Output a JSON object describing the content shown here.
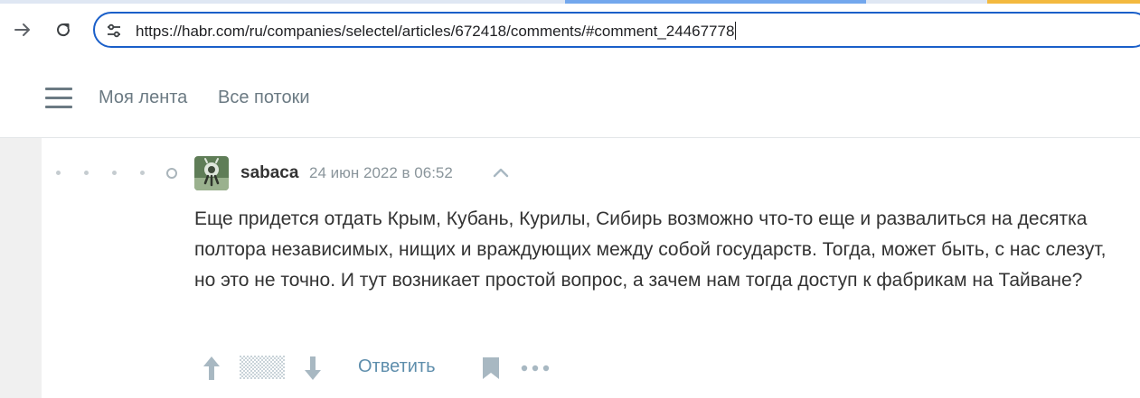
{
  "browser": {
    "url": "https://habr.com/ru/companies/selectel/articles/672418/comments/#comment_24467778",
    "forward_icon": "arrow-right-icon",
    "reload_icon": "reload-icon",
    "site_info_icon": "tune-icon"
  },
  "header": {
    "menu_icon": "hamburger-icon",
    "nav": [
      "Моя лента",
      "Все потоки"
    ]
  },
  "comment": {
    "author": "sabaca",
    "date": "24 июн 2022 в 06:52",
    "text": "Еще придется отдать Крым, Кубань, Курилы, Сибирь возможно что-то еще и развалиться на десятка полтора независимых, нищих и враждующих между собой государств. Тогда, может быть, с нас слезут, но это не точно. И тут возникает простой вопрос, а зачем нам тогда доступ к фабрикам на Тайване?",
    "actions": {
      "reply_label": "Ответить"
    }
  },
  "colors": {
    "url_border": "#1a5fc9",
    "link": "#5e8eac",
    "muted": "#8a959b",
    "text": "#333333",
    "icon": "#a8b8c2"
  }
}
